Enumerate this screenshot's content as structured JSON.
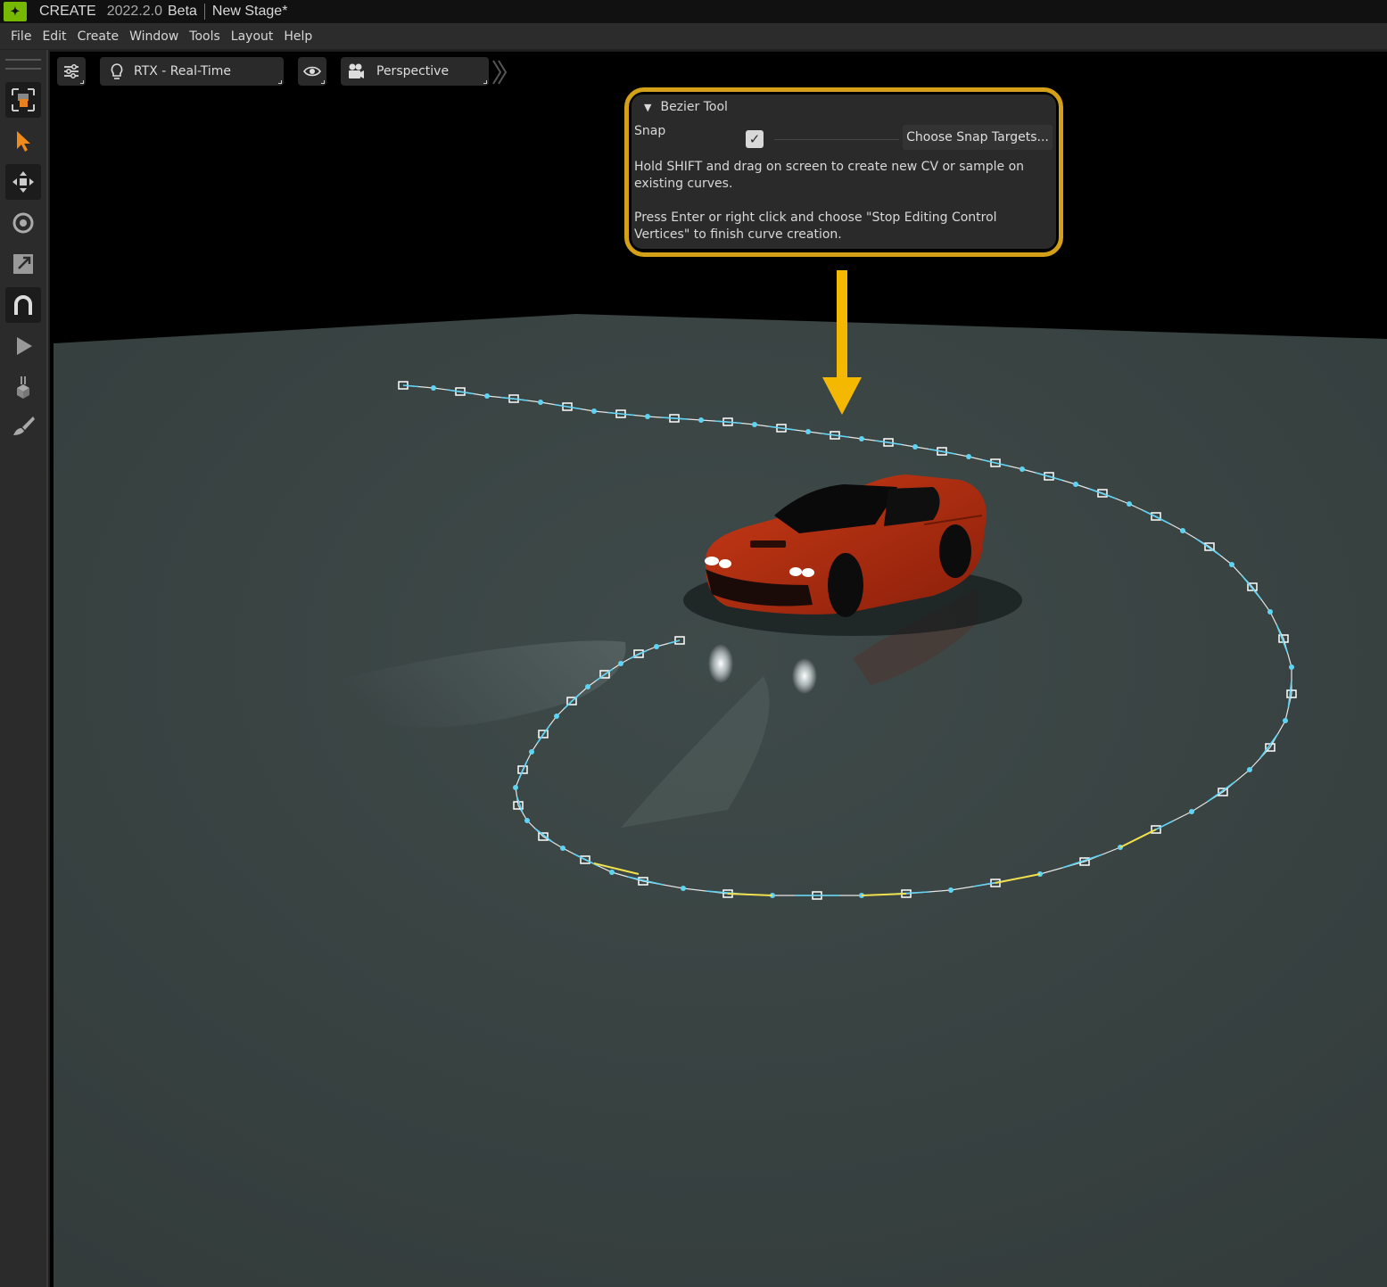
{
  "titlebar": {
    "app_name": "CREATE",
    "version": "2022.2.0",
    "channel": "Beta",
    "document": "New Stage*"
  },
  "menu": [
    "File",
    "Edit",
    "Create",
    "Window",
    "Tools",
    "Layout",
    "Help"
  ],
  "left_toolbar": {
    "tools": [
      {
        "name": "select-mode-icon"
      },
      {
        "name": "select-arrow-icon"
      },
      {
        "name": "move-icon"
      },
      {
        "name": "rotate-icon"
      },
      {
        "name": "scale-icon"
      },
      {
        "name": "snap-magnet-icon"
      },
      {
        "name": "play-icon"
      },
      {
        "name": "drop-icon"
      },
      {
        "name": "paint-brush-icon"
      }
    ]
  },
  "viewport_toolbar": {
    "render_mode": "RTX - Real-Time",
    "camera": "Perspective"
  },
  "bezier_panel": {
    "title": "Bezier Tool",
    "snap_label": "Snap",
    "snap_checked": true,
    "snap_targets_button": "Choose Snap Targets...",
    "help_line1": "Hold SHIFT and drag on screen to create new CV or sample on existing curves.",
    "help_line2": "Press Enter or right click and choose \"Stop Editing Control Vertices\" to finish curve creation."
  },
  "colors": {
    "highlight": "#d4a017",
    "arrow": "#f5b800",
    "floor": "#3a4544",
    "curve_point": "#5fd3f3",
    "curve_tangent": "#f2e14c",
    "car_body": "#b52d10"
  }
}
